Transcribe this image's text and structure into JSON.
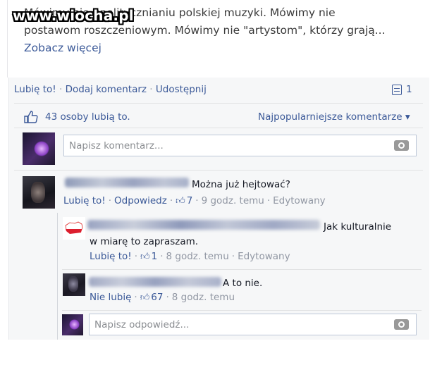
{
  "watermark": "www.wiocha.pl",
  "post": {
    "text": "Mówimy nie upolitycznianiu polskiej muzyki. Mówimy nie postawom roszczeniowym. Mówimy nie \"artystom\", którzy grają... ",
    "see_more": "Zobacz więcej"
  },
  "actions": {
    "like": "Lubię to!",
    "comment": "Dodaj komentarz",
    "share": "Udostępnij",
    "separator": "·",
    "comment_count": "1"
  },
  "likes": {
    "text": "43 osoby lubią to.",
    "sort_label": "Najpopularniejsze komentarze ▾"
  },
  "new_comment": {
    "placeholder": "Napisz komentarz..."
  },
  "comments": [
    {
      "text": "Można już hejtować?",
      "like": "Lubię to!",
      "reply": "Odpowiedz",
      "likes": "7",
      "time": "9 godz. temu",
      "edited": "Edytowany",
      "replies": [
        {
          "text_line1": "Jak kulturalnie",
          "text_line2": "w miarę to zapraszam.",
          "like": "Lubię to!",
          "likes": "1",
          "time": "8 godz. temu",
          "edited": "Edytowany"
        },
        {
          "text": "A to nie.",
          "like": "Nie lubię",
          "likes": "67",
          "time": "8 godz. temu"
        }
      ]
    }
  ],
  "reply_input": {
    "placeholder": "Napisz odpowiedź..."
  },
  "colors": {
    "link": "#3b5998",
    "meta": "#9197a3",
    "feedback_bg": "#f6f7f8",
    "input_border": "#bdc7d8"
  }
}
